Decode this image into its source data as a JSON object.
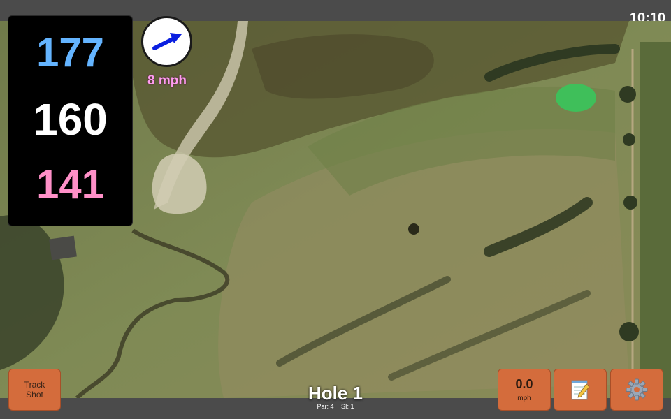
{
  "status": {
    "time": "10:10"
  },
  "distances": {
    "back": "177",
    "middle": "160",
    "front": "141"
  },
  "wind": {
    "speed": "8 mph",
    "arrow_icon": "wind-arrow-icon"
  },
  "hole": {
    "title": "Hole 1",
    "par": "Par: 4",
    "si": "SI: 1"
  },
  "buttons": {
    "track_shot": [
      "Track",
      "Shot"
    ],
    "speed_value": "0.0",
    "speed_unit": "mph",
    "notes_icon": "notepad-icon",
    "settings_icon": "gear-icon"
  },
  "colors": {
    "back_distance": "#64b4ff",
    "middle_distance": "#ffffff",
    "front_distance": "#ff90c8",
    "wind_text": "#ff9cf0",
    "button_bg": "#d46c3c",
    "green": "#3fbf5a"
  }
}
